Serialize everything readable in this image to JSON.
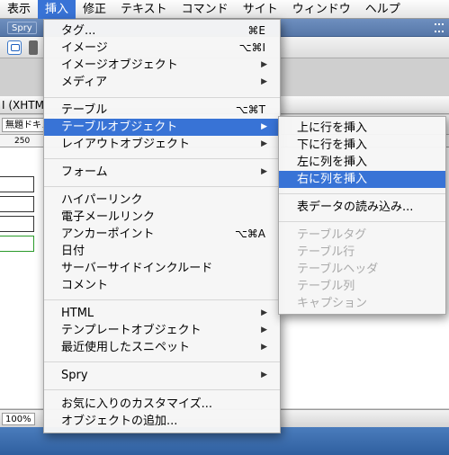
{
  "menubar": {
    "items": [
      {
        "label": "表示"
      },
      {
        "label": "挿入",
        "active": true
      },
      {
        "label": "修正"
      },
      {
        "label": "テキスト"
      },
      {
        "label": "コマンド"
      },
      {
        "label": "サイト"
      },
      {
        "label": "ウィンドウ"
      },
      {
        "label": "ヘルプ"
      }
    ]
  },
  "background": {
    "insert_panel_tab": "Spry",
    "doc_title": "I (XHTM",
    "doc_tab": "無題ドキュ",
    "ruler_tick": "250",
    "zoom": "100%"
  },
  "insert_menu": {
    "items": [
      {
        "label": "タグ...",
        "shortcut": "⌘E"
      },
      {
        "label": "イメージ",
        "shortcut": "⌥⌘I"
      },
      {
        "label": "イメージオブジェクト",
        "submenu": true
      },
      {
        "label": "メディア",
        "submenu": true
      },
      {
        "label": "テーブル",
        "shortcut": "⌥⌘T"
      },
      {
        "label": "テーブルオブジェクト",
        "submenu": true,
        "highlighted": true
      },
      {
        "label": "レイアウトオブジェクト",
        "submenu": true
      },
      {
        "label": "フォーム",
        "submenu": true
      },
      {
        "label": "ハイパーリンク"
      },
      {
        "label": "電子メールリンク"
      },
      {
        "label": "アンカーポイント",
        "shortcut": "⌥⌘A"
      },
      {
        "label": "日付"
      },
      {
        "label": "サーバーサイドインクルード"
      },
      {
        "label": "コメント"
      },
      {
        "label": "HTML",
        "submenu": true
      },
      {
        "label": "テンプレートオブジェクト",
        "submenu": true
      },
      {
        "label": "最近使用したスニペット",
        "submenu": true
      },
      {
        "label": "Spry",
        "submenu": true
      },
      {
        "label": "お気に入りのカスタマイズ..."
      },
      {
        "label": "オブジェクトの追加..."
      }
    ],
    "submenu_arrow": "▶"
  },
  "table_objects_submenu": {
    "items": [
      {
        "label": "上に行を挿入"
      },
      {
        "label": "下に行を挿入"
      },
      {
        "label": "左に列を挿入"
      },
      {
        "label": "右に列を挿入",
        "highlighted": true
      },
      {
        "label": "表データの読み込み..."
      },
      {
        "label": "テーブルタグ",
        "disabled": true
      },
      {
        "label": "テーブル行",
        "disabled": true
      },
      {
        "label": "テーブルヘッダ",
        "disabled": true
      },
      {
        "label": "テーブル列",
        "disabled": true
      },
      {
        "label": "キャプション",
        "disabled": true
      }
    ]
  },
  "colors": {
    "highlight": "#3873d6",
    "disabled_text": "#a9a9a9",
    "desktop": "#3f74b4"
  }
}
